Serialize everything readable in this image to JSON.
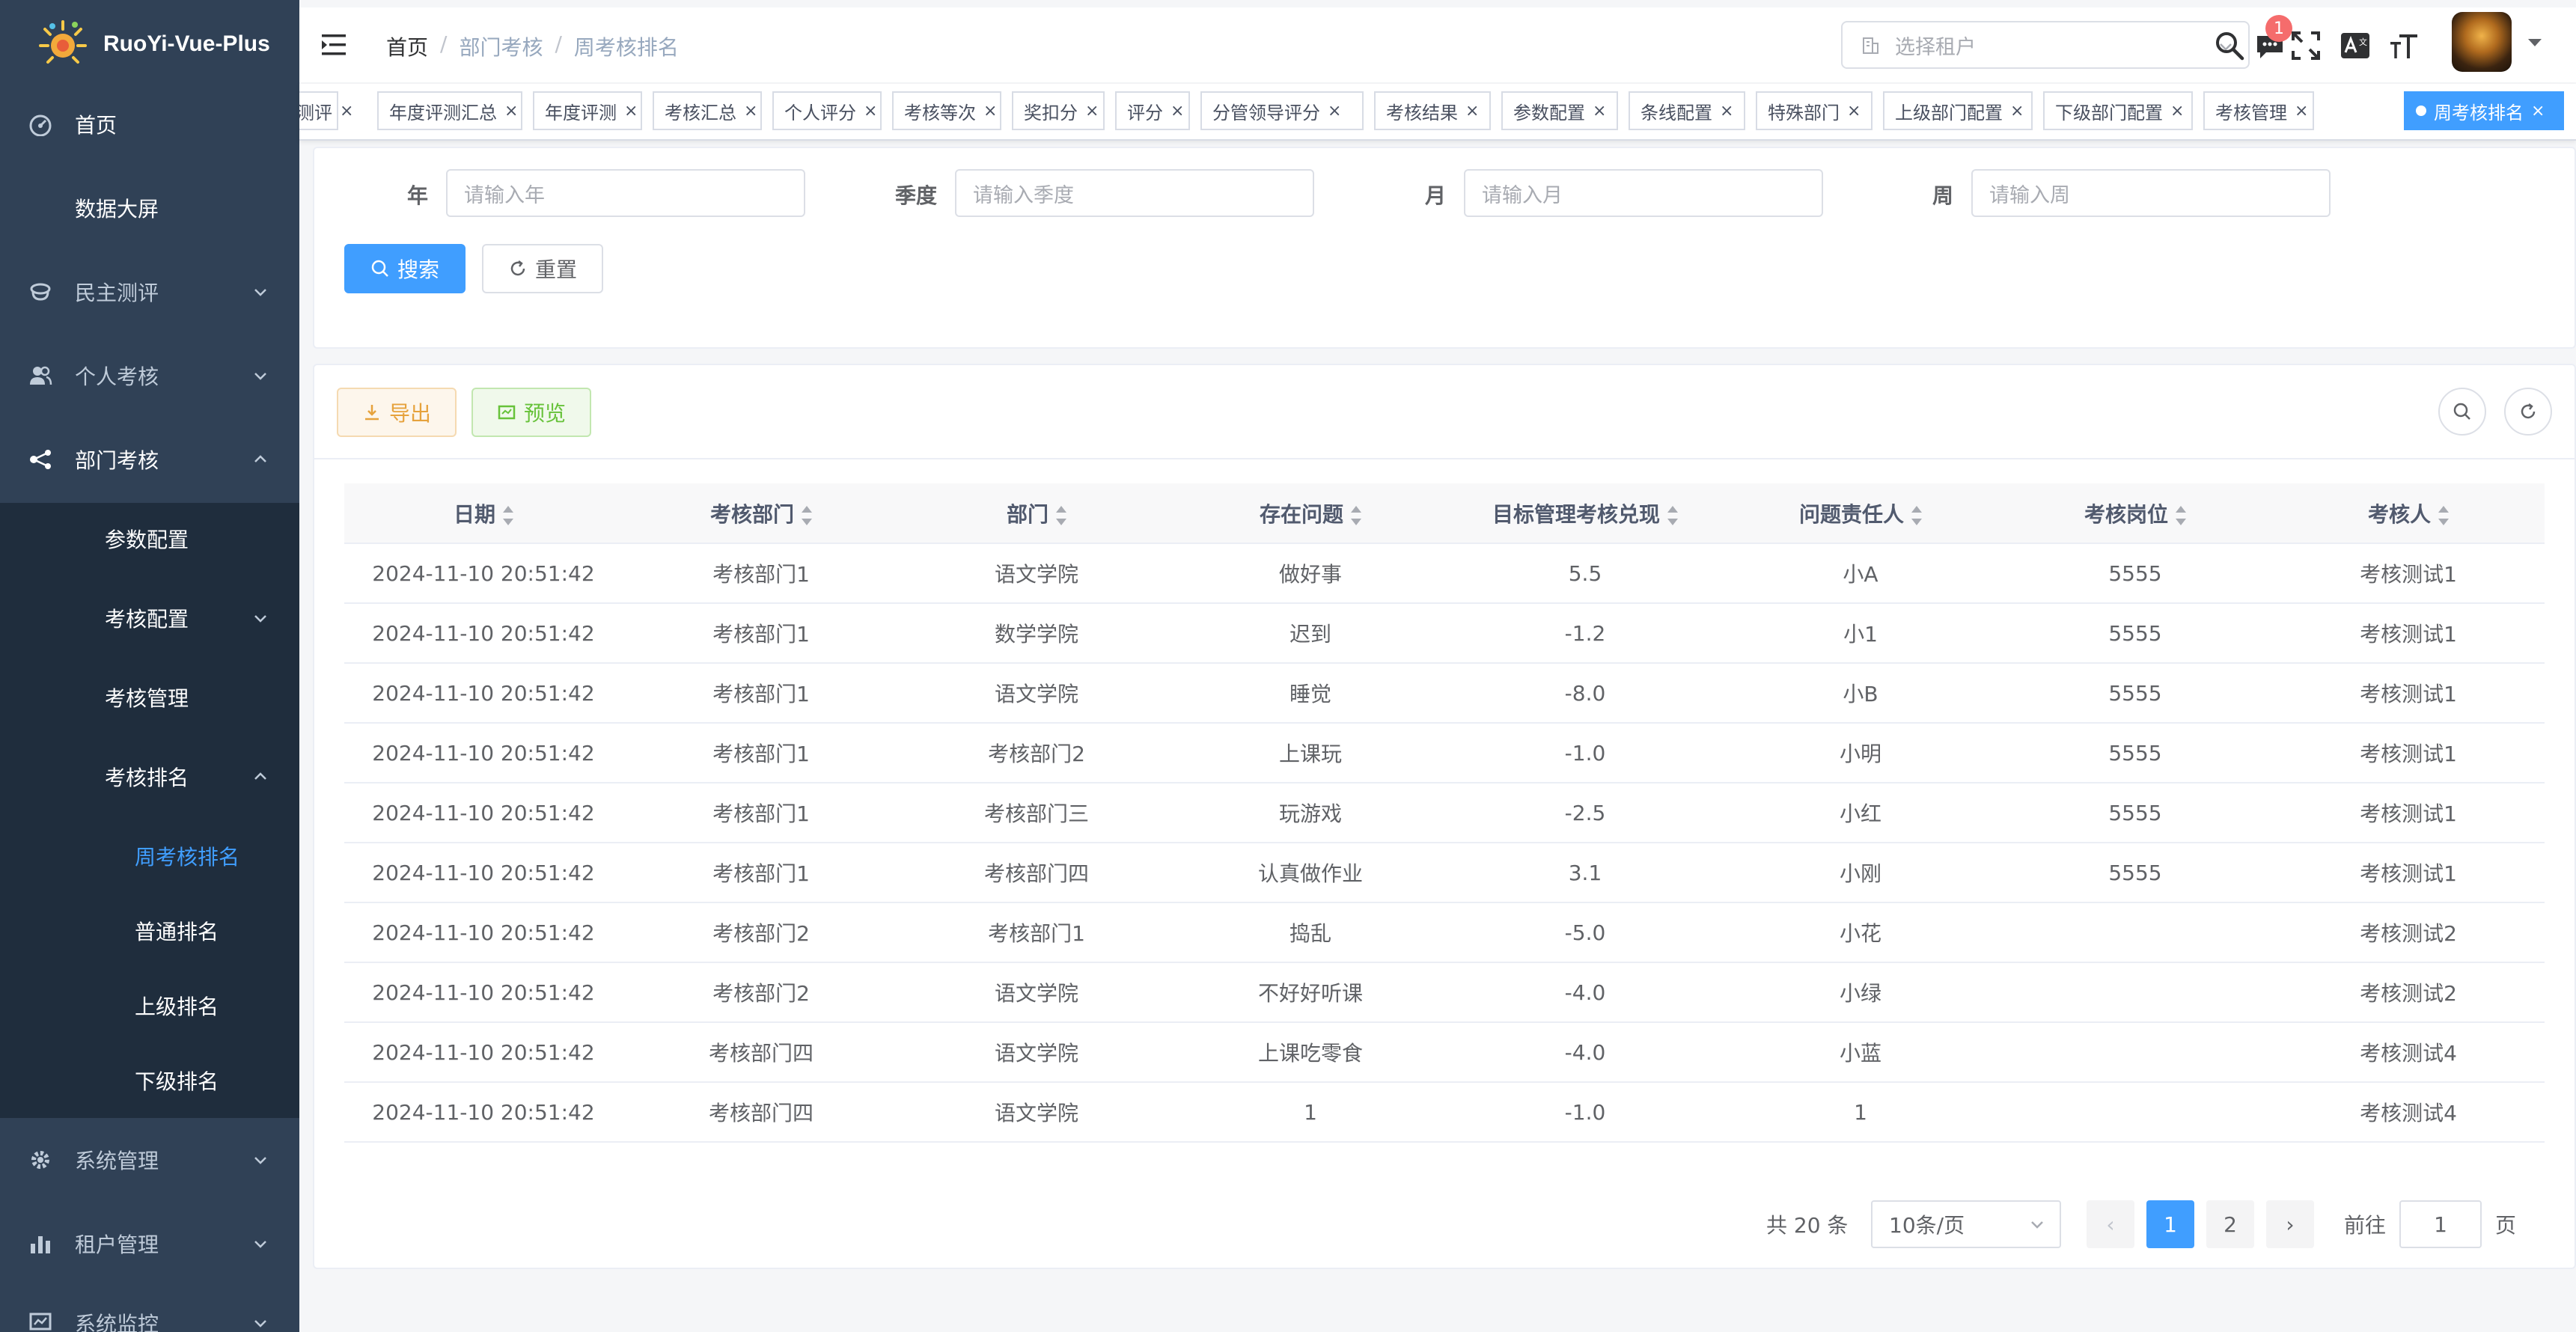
{
  "app": {
    "title": "RuoYi-Vue-Plus"
  },
  "sidebar": {
    "items": [
      {
        "label": "首页",
        "icon": "dashboard-icon"
      },
      {
        "label": "数据大屏"
      },
      {
        "label": "民主测评",
        "icon": "survey-icon"
      },
      {
        "label": "个人考核",
        "icon": "peoples-icon"
      },
      {
        "label": "部门考核",
        "icon": "tree-icon"
      },
      {
        "label": "参数配置"
      },
      {
        "label": "考核配置"
      },
      {
        "label": "考核管理"
      },
      {
        "label": "考核排名"
      },
      {
        "label": "周考核排名"
      },
      {
        "label": "普通排名"
      },
      {
        "label": "上级排名"
      },
      {
        "label": "下级排名"
      },
      {
        "label": "系统管理",
        "icon": "system-icon"
      },
      {
        "label": "租户管理",
        "icon": "chart-icon"
      },
      {
        "label": "系统监控",
        "icon": "monitor-icon"
      }
    ]
  },
  "header": {
    "breadcrumb": [
      "首页",
      "部门考核",
      "周考核排名"
    ],
    "tenant_placeholder": "选择租户",
    "notice_count": "1"
  },
  "tags": [
    "测评",
    "年度评测汇总",
    "年度评测",
    "考核汇总",
    "个人评分",
    "考核等次",
    "奖扣分",
    "评分",
    "分管领导评分",
    "考核结果",
    "参数配置",
    "条线配置",
    "特殊部门",
    "上级部门配置",
    "下级部门配置",
    "考核管理",
    "周考核排名"
  ],
  "search": {
    "fields": [
      {
        "label": "年",
        "placeholder": "请输入年"
      },
      {
        "label": "季度",
        "placeholder": "请输入季度"
      },
      {
        "label": "月",
        "placeholder": "请输入月"
      },
      {
        "label": "周",
        "placeholder": "请输入周"
      }
    ],
    "search_label": "搜索",
    "reset_label": "重置"
  },
  "toolbar": {
    "export_label": "导出",
    "preview_label": "预览"
  },
  "table": {
    "columns": [
      "日期",
      "考核部门",
      "部门",
      "存在问题",
      "目标管理考核兑现",
      "问题责任人",
      "考核岗位",
      "考核人"
    ],
    "rows": [
      [
        "2024-11-10 20:51:42",
        "考核部门1",
        "语文学院",
        "做好事",
        "5.5",
        "小A",
        "5555",
        "考核测试1"
      ],
      [
        "2024-11-10 20:51:42",
        "考核部门1",
        "数学学院",
        "迟到",
        "-1.2",
        "小1",
        "5555",
        "考核测试1"
      ],
      [
        "2024-11-10 20:51:42",
        "考核部门1",
        "语文学院",
        "睡觉",
        "-8.0",
        "小B",
        "5555",
        "考核测试1"
      ],
      [
        "2024-11-10 20:51:42",
        "考核部门1",
        "考核部门2",
        "上课玩",
        "-1.0",
        "小明",
        "5555",
        "考核测试1"
      ],
      [
        "2024-11-10 20:51:42",
        "考核部门1",
        "考核部门三",
        "玩游戏",
        "-2.5",
        "小红",
        "5555",
        "考核测试1"
      ],
      [
        "2024-11-10 20:51:42",
        "考核部门1",
        "考核部门四",
        "认真做作业",
        "3.1",
        "小刚",
        "5555",
        "考核测试1"
      ],
      [
        "2024-11-10 20:51:42",
        "考核部门2",
        "考核部门1",
        "捣乱",
        "-5.0",
        "小花",
        "",
        "考核测试2"
      ],
      [
        "2024-11-10 20:51:42",
        "考核部门2",
        "语文学院",
        "不好好听课",
        "-4.0",
        "小绿",
        "",
        "考核测试2"
      ],
      [
        "2024-11-10 20:51:42",
        "考核部门四",
        "语文学院",
        "上课吃零食",
        "-4.0",
        "小蓝",
        "",
        "考核测试4"
      ],
      [
        "2024-11-10 20:51:42",
        "考核部门四",
        "语文学院",
        "1",
        "-1.0",
        "1",
        "",
        "考核测试4"
      ]
    ]
  },
  "pagination": {
    "total_text": "共 20 条",
    "page_size": "10条/页",
    "pages": [
      "1",
      "2"
    ],
    "current": "1",
    "goto_label": "前往",
    "goto_value": "1",
    "page_unit": "页"
  },
  "colors": {
    "primary": "#409eff",
    "sidebar_bg": "#304156",
    "submenu_bg": "#1f2d3d"
  }
}
